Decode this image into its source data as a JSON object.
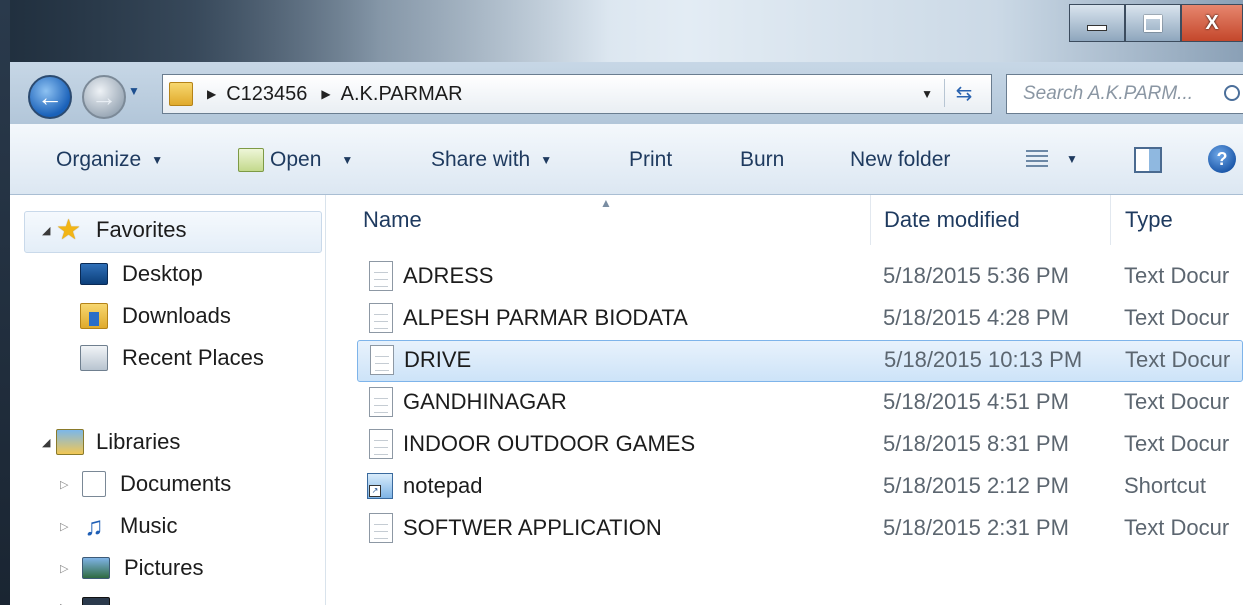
{
  "window": {
    "minimize_label": "–",
    "maximize_label": "□",
    "close_label": "X"
  },
  "nav": {
    "breadcrumb": [
      "C123456",
      "A.K.PARMAR"
    ],
    "search_placeholder": "Search A.K.PARM..."
  },
  "toolbar": {
    "organize": "Organize",
    "open": "Open",
    "share_with": "Share with",
    "print": "Print",
    "burn": "Burn",
    "new_folder": "New folder",
    "help": "?"
  },
  "sidebar": {
    "favorites": "Favorites",
    "favorites_items": [
      "Desktop",
      "Downloads",
      "Recent Places"
    ],
    "libraries": "Libraries",
    "libraries_items": [
      "Documents",
      "Music",
      "Pictures"
    ]
  },
  "columns": {
    "name": "Name",
    "date_modified": "Date modified",
    "type": "Type"
  },
  "files": [
    {
      "name": "ADRESS",
      "date": "5/18/2015 5:36 PM",
      "type": "Text Docur",
      "icon": "text-file-icon"
    },
    {
      "name": "ALPESH PARMAR BIODATA",
      "date": "5/18/2015 4:28 PM",
      "type": "Text Docur",
      "icon": "text-file-icon"
    },
    {
      "name": "DRIVE",
      "date": "5/18/2015 10:13 PM",
      "type": "Text Docur",
      "icon": "text-file-icon",
      "selected": true
    },
    {
      "name": "GANDHINAGAR",
      "date": "5/18/2015 4:51 PM",
      "type": "Text Docur",
      "icon": "text-file-icon"
    },
    {
      "name": "INDOOR OUTDOOR GAMES",
      "date": "5/18/2015 8:31 PM",
      "type": "Text Docur",
      "icon": "text-file-icon"
    },
    {
      "name": "notepad",
      "date": "5/18/2015 2:12 PM",
      "type": "Shortcut",
      "icon": "shortcut-icon"
    },
    {
      "name": "SOFTWER APPLICATION",
      "date": "5/18/2015 2:31 PM",
      "type": "Text Docur",
      "icon": "text-file-icon"
    }
  ]
}
